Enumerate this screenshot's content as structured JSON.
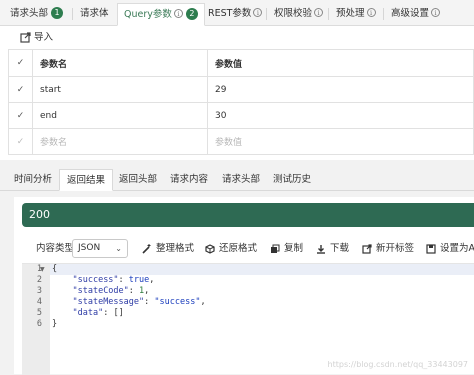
{
  "request_tabs": [
    {
      "label": "请求头部",
      "badge": "1"
    },
    {
      "label": "请求体"
    },
    {
      "label": "Query参数",
      "badge": "2",
      "info": "i"
    },
    {
      "label": "REST参数",
      "info": "i"
    },
    {
      "label": "权限校验",
      "info": "i"
    },
    {
      "label": "预处理",
      "info": "i"
    },
    {
      "label": "高级设置",
      "info": "i"
    }
  ],
  "import_label": "导入",
  "params": {
    "headers": [
      "参数名",
      "参数值"
    ],
    "rows": [
      {
        "name": "start",
        "value": "29"
      },
      {
        "name": "end",
        "value": "30"
      }
    ],
    "placeholder_name": "参数名",
    "placeholder_value": "参数值"
  },
  "response_tabs": [
    "时间分析",
    "返回结果",
    "返回头部",
    "请求内容",
    "请求头部",
    "测试历史"
  ],
  "status_code": "200",
  "toolbar": {
    "content_type_label": "内容类型",
    "content_type_value": "JSON",
    "format_label": "整理格式",
    "restore_label": "还原格式",
    "copy_label": "复制",
    "download_label": "下载",
    "new_tab_label": "新开标签",
    "set_as_label": "设置为Al"
  },
  "code_lines": [
    {
      "n": "1",
      "text": "{"
    },
    {
      "n": "2",
      "key": "\"success\"",
      "sep": ": ",
      "val": "true",
      "vtype": "b",
      "end": ","
    },
    {
      "n": "3",
      "key": "\"stateCode\"",
      "sep": ": ",
      "val": "1",
      "vtype": "n",
      "end": ","
    },
    {
      "n": "4",
      "key": "\"stateMessage\"",
      "sep": ": ",
      "val": "\"success\"",
      "vtype": "s",
      "end": ","
    },
    {
      "n": "5",
      "key": "\"data\"",
      "sep": ": ",
      "val": "[]",
      "vtype": "p",
      "end": ""
    },
    {
      "n": "6",
      "text": "}"
    }
  ],
  "watermark": "https://blog.csdn.net/qq_33443097"
}
